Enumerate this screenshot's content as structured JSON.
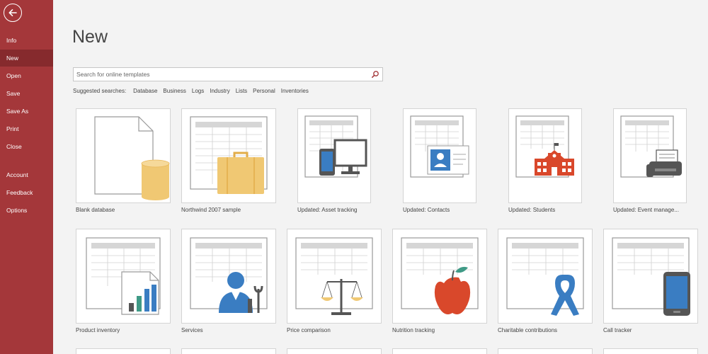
{
  "sidebar": {
    "back_label": "Back",
    "items": [
      {
        "label": "Info"
      },
      {
        "label": "New"
      },
      {
        "label": "Open"
      },
      {
        "label": "Save"
      },
      {
        "label": "Save As"
      },
      {
        "label": "Print"
      },
      {
        "label": "Close"
      },
      {
        "label": "Account"
      },
      {
        "label": "Feedback"
      },
      {
        "label": "Options"
      }
    ],
    "active": "New"
  },
  "main": {
    "title": "New",
    "search": {
      "placeholder": "Search for online templates",
      "value": ""
    },
    "suggested": {
      "label": "Suggested searches:",
      "links": [
        "Database",
        "Business",
        "Logs",
        "Industry",
        "Lists",
        "Personal",
        "Inventories"
      ]
    },
    "templates": [
      {
        "label": "Blank database",
        "icon": "blank-database-icon"
      },
      {
        "label": "Northwind 2007 sample",
        "icon": "briefcase-icon"
      },
      {
        "label": "Updated: Asset tracking",
        "icon": "devices-icon"
      },
      {
        "label": "Updated: Contacts",
        "icon": "contact-card-icon"
      },
      {
        "label": "Updated: Students",
        "icon": "school-icon"
      },
      {
        "label": "Updated: Event manage...",
        "icon": "printer-icon"
      },
      {
        "label": "Product inventory",
        "icon": "bar-chart-icon"
      },
      {
        "label": "Services",
        "icon": "technician-icon"
      },
      {
        "label": "Price comparison",
        "icon": "scale-icon"
      },
      {
        "label": "Nutrition tracking",
        "icon": "apple-icon"
      },
      {
        "label": "Charitable contributions",
        "icon": "ribbon-icon"
      },
      {
        "label": "Call tracker",
        "icon": "phone-icon"
      }
    ]
  },
  "colors": {
    "sidebar": "#a4373a",
    "sidebar_active": "#862a2d",
    "accent_blue": "#3a7dc2",
    "accent_yellow": "#f0c873",
    "accent_red": "#d9482b"
  }
}
